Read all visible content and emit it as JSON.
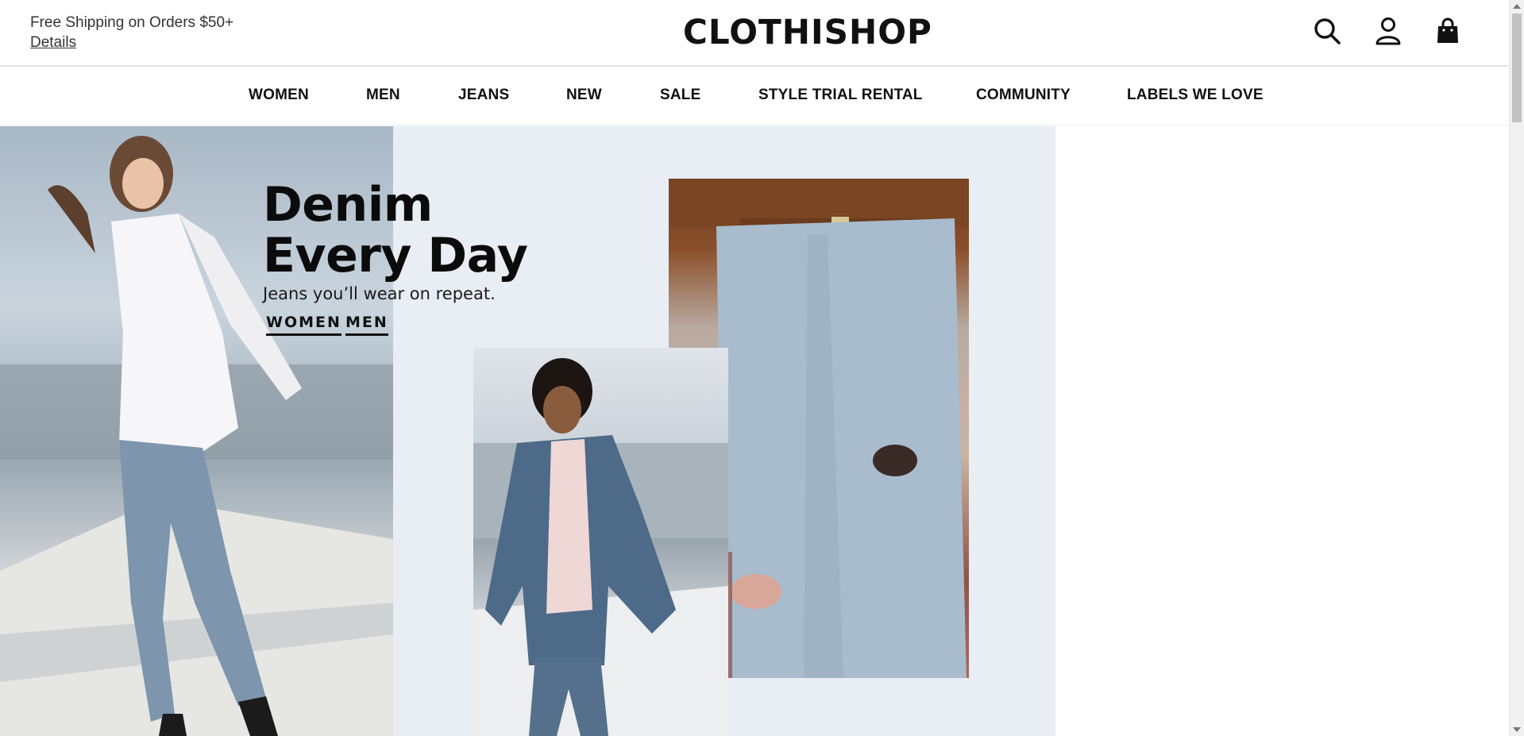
{
  "promo": {
    "text": "Free Shipping on Orders $50+",
    "details_label": "Details"
  },
  "brand": {
    "logo_text": "CLOTHISHOP"
  },
  "header_icons": [
    "search-icon",
    "account-icon",
    "bag-icon"
  ],
  "nav": {
    "items": [
      {
        "label": "WOMEN"
      },
      {
        "label": "MEN"
      },
      {
        "label": "JEANS"
      },
      {
        "label": "NEW"
      },
      {
        "label": "SALE"
      },
      {
        "label": "STYLE TRIAL RENTAL"
      },
      {
        "label": "COMMUNITY"
      },
      {
        "label": "LABELS WE LOVE"
      }
    ]
  },
  "hero": {
    "headline_line1": "Denim",
    "headline_line2": "Every Day",
    "subline": "Jeans you’ll wear on repeat.",
    "cta_women": "WOMEN",
    "cta_men": "MEN",
    "background_color": "#e9edf4"
  },
  "colors": {
    "text": "#111111",
    "promo_text": "#333333",
    "divider": "#e3e3e3"
  }
}
